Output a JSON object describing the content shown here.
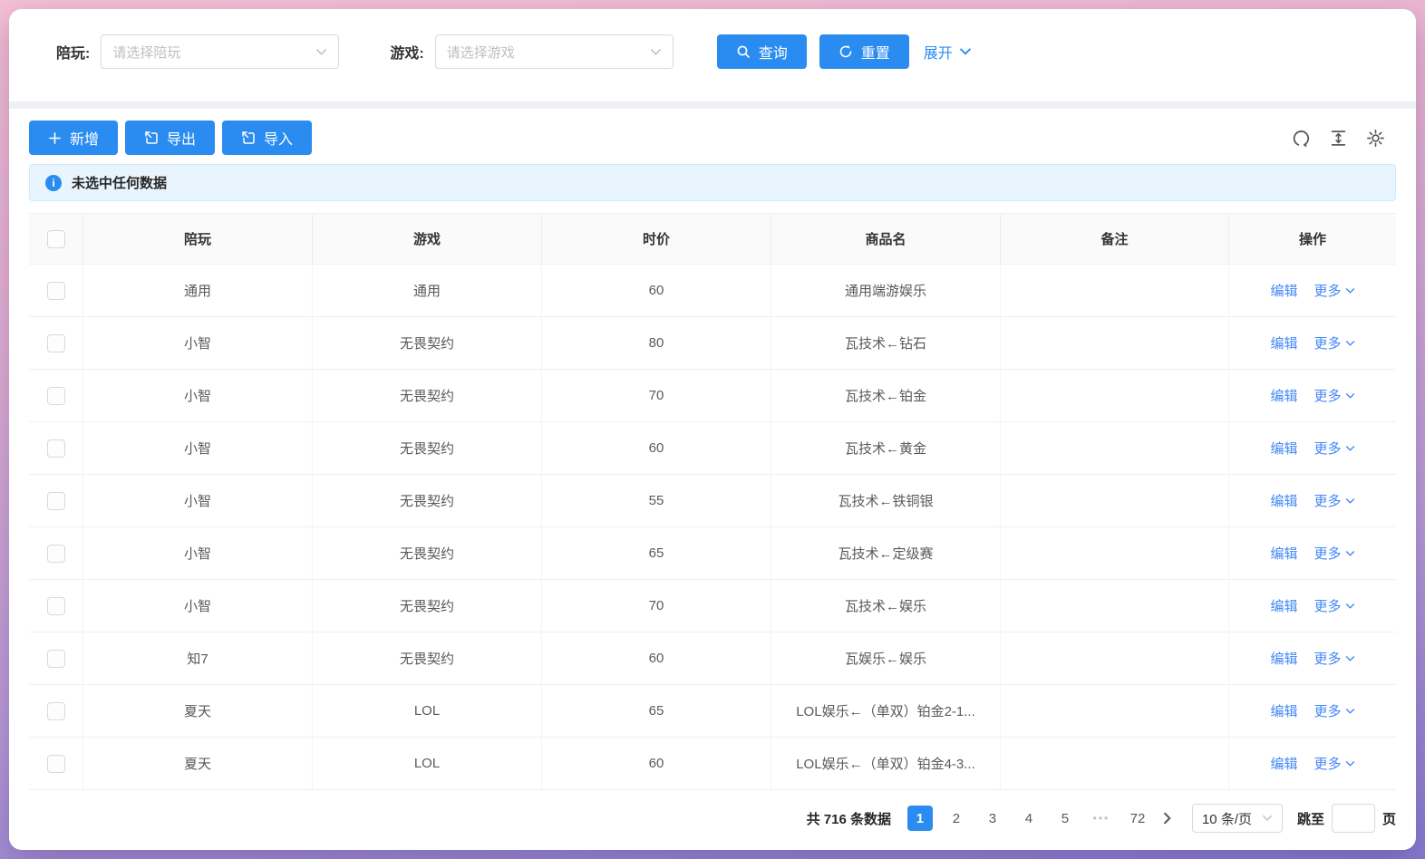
{
  "filters": {
    "peiwan_label": "陪玩:",
    "peiwan_placeholder": "请选择陪玩",
    "game_label": "游戏:",
    "game_placeholder": "请选择游戏",
    "search_button": "查询",
    "reset_button": "重置",
    "expand_link": "展开"
  },
  "toolbar": {
    "add_button": "新增",
    "export_button": "导出",
    "import_button": "导入"
  },
  "alert": {
    "text": "未选中任何数据"
  },
  "table": {
    "columns": [
      "陪玩",
      "游戏",
      "时价",
      "商品名",
      "备注",
      "操作"
    ],
    "actions": {
      "edit": "编辑",
      "more": "更多"
    },
    "rows": [
      {
        "peiwan": "通用",
        "game": "通用",
        "price": "60",
        "product": "通用端游娱乐",
        "note": ""
      },
      {
        "peiwan": "小智",
        "game": "无畏契约",
        "price": "80",
        "product": "瓦技术←钻石",
        "note": ""
      },
      {
        "peiwan": "小智",
        "game": "无畏契约",
        "price": "70",
        "product": "瓦技术←铂金",
        "note": ""
      },
      {
        "peiwan": "小智",
        "game": "无畏契约",
        "price": "60",
        "product": "瓦技术←黄金",
        "note": ""
      },
      {
        "peiwan": "小智",
        "game": "无畏契约",
        "price": "55",
        "product": "瓦技术←铁铜银",
        "note": ""
      },
      {
        "peiwan": "小智",
        "game": "无畏契约",
        "price": "65",
        "product": "瓦技术←定级赛",
        "note": ""
      },
      {
        "peiwan": "小智",
        "game": "无畏契约",
        "price": "70",
        "product": "瓦技术←娱乐",
        "note": ""
      },
      {
        "peiwan": "知7",
        "game": "无畏契约",
        "price": "60",
        "product": "瓦娱乐←娱乐",
        "note": ""
      },
      {
        "peiwan": "夏天",
        "game": "LOL",
        "price": "65",
        "product": "LOL娱乐←（单双）铂金2-1...",
        "note": ""
      },
      {
        "peiwan": "夏天",
        "game": "LOL",
        "price": "60",
        "product": "LOL娱乐←（单双）铂金4-3...",
        "note": ""
      }
    ]
  },
  "pagination": {
    "total_text": "共 716 条数据",
    "pages": [
      "1",
      "2",
      "3",
      "4",
      "5",
      "•••",
      "72"
    ],
    "active_page": "1",
    "page_size": "10 条/页",
    "jump_label": "跳至",
    "jump_value": "",
    "jump_suffix": "页"
  },
  "colors": {
    "primary": "#2a8cf0",
    "link": "#4287f5",
    "alert_bg": "#e9f5fe",
    "frame_top": "#f5c1d3",
    "frame_bottom": "#8579d0"
  }
}
